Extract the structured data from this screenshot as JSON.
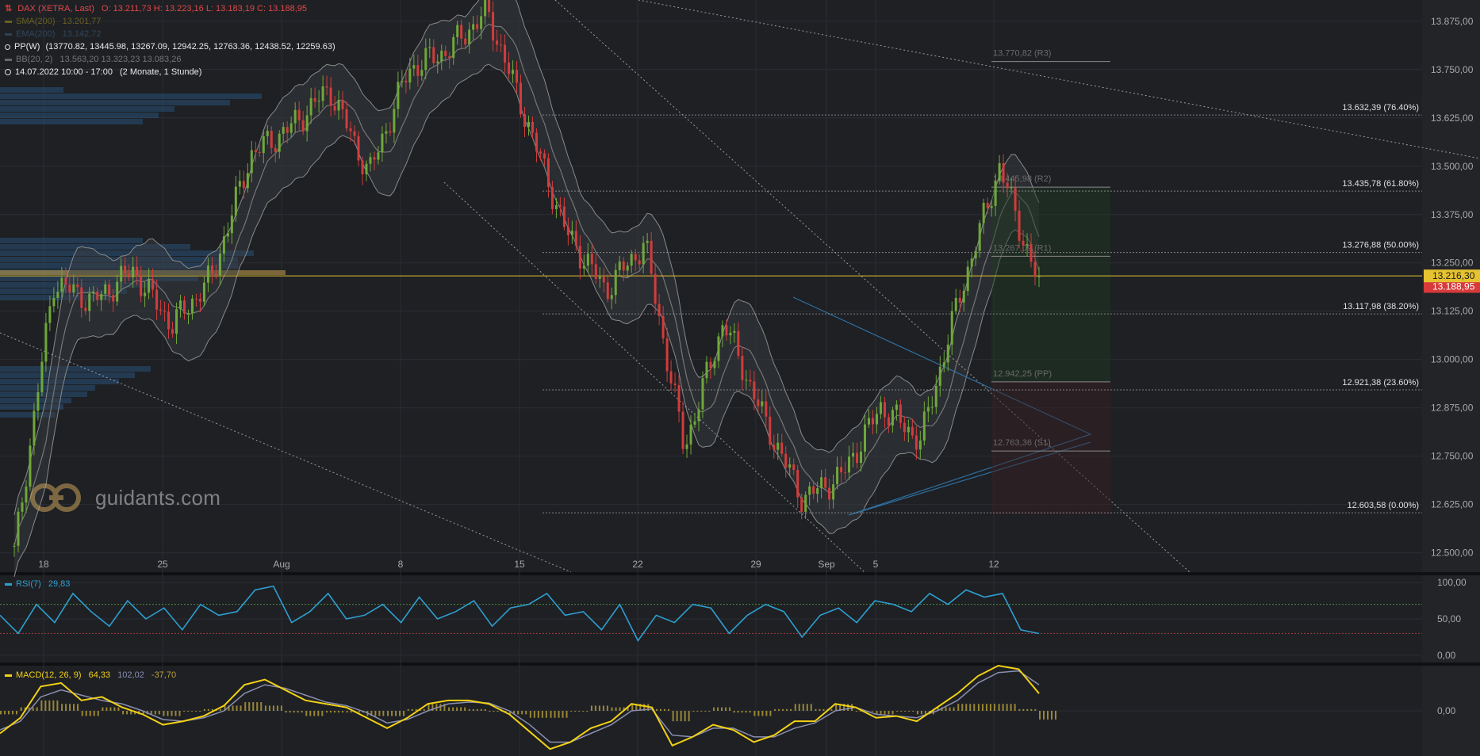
{
  "header": {
    "symbol": "DAX (XETRA, Last)",
    "ohlc": "O: 13.211,73  H: 13.223,16  L: 13.183,19  C: 13.188,95",
    "sma_label": "SMA(200)",
    "sma_value": "13.201,77",
    "ema_label": "EMA(200)",
    "ema_value": "13.142,72",
    "pp_label": "PP(W)",
    "pp_values": "(13770.82, 13445.98, 13267.09, 12942.25, 12763.36, 12438.52, 12259.63)",
    "bb_label": "BB(20, 2)",
    "bb_values": "13.563,20  13.323,23  13.083,26",
    "period": "14.07.2022 10:00 - 17:00",
    "period_note": "(2 Monate, 1 Stunde)"
  },
  "brand": {
    "text": "guidants.com"
  },
  "colors": {
    "up": "#6fa83a",
    "down": "#d23c3c",
    "rsi": "#2e9fd0",
    "macd": "#f2d114",
    "signal": "#8a8fb0",
    "hist": "#b8a03a",
    "price_marker": "#e5c22f",
    "close_marker": "#d83a3a"
  },
  "chart_data": [
    {
      "type": "line",
      "title": "DAX (XETRA, Last)",
      "price_axis_ticks": [
        "13.875,00",
        "13.750,00",
        "13.625,00",
        "13.500,00",
        "13.375,00",
        "13.250,00",
        "13.125,00",
        "13.000,00",
        "12.875,00",
        "12.750,00",
        "12.625,00",
        "12.500,00"
      ],
      "date_axis_ticks": [
        "18",
        "25",
        "Aug",
        "8",
        "15",
        "22",
        "29",
        "Sep",
        "5",
        "12"
      ],
      "ylim": [
        12450,
        13930
      ],
      "price_markers": {
        "last": "13.216,30",
        "close": "13.188,95"
      },
      "close_approx": [
        {
          "x": "18",
          "y": 12500
        },
        {
          "x": "20",
          "y": 13200
        },
        {
          "x": "22",
          "y": 13150
        },
        {
          "x": "25",
          "y": 13230
        },
        {
          "x": "27",
          "y": 13090
        },
        {
          "x": "Aug",
          "y": 13210
        },
        {
          "x": "3",
          "y": 13530
        },
        {
          "x": "5",
          "y": 13600
        },
        {
          "x": "8",
          "y": 13700
        },
        {
          "x": "10",
          "y": 13480
        },
        {
          "x": "12",
          "y": 13750
        },
        {
          "x": "15",
          "y": 13800
        },
        {
          "x": "16",
          "y": 13900
        },
        {
          "x": "18",
          "y": 13620
        },
        {
          "x": "22",
          "y": 13330
        },
        {
          "x": "24",
          "y": 13180
        },
        {
          "x": "26",
          "y": 13300
        },
        {
          "x": "29",
          "y": 12770
        },
        {
          "x": "31",
          "y": 13100
        },
        {
          "x": "Sep",
          "y": 12850
        },
        {
          "x": "2",
          "y": 12640
        },
        {
          "x": "5",
          "y": 12700
        },
        {
          "x": "7",
          "y": 12880
        },
        {
          "x": "9",
          "y": 12790
        },
        {
          "x": "12",
          "y": 13170
        },
        {
          "x": "13",
          "y": 13500
        },
        {
          "x": "14",
          "y": 13189
        }
      ],
      "fibonacci_levels": [
        {
          "label": "13.632,39 (76.40%)",
          "value": 13632.39
        },
        {
          "label": "13.435,78 (61.80%)",
          "value": 13435.78
        },
        {
          "label": "13.276,88 (50.00%)",
          "value": 13276.88
        },
        {
          "label": "13.117,98 (38.20%)",
          "value": 13117.98
        },
        {
          "label": "12.921,38 (23.60%)",
          "value": 12921.38
        },
        {
          "label": "12.603,58 (0.00%)",
          "value": 12603.58
        }
      ],
      "pivot_levels": [
        {
          "label": "13.770,82 (R3)",
          "value": 13770.82
        },
        {
          "label": "13.445,98 (R2)",
          "value": 13445.98
        },
        {
          "label": "13.267,09 (R1)",
          "value": 13267.09
        },
        {
          "label": "12.942,25 (PP)",
          "value": 12942.25
        },
        {
          "label": "12.763,36 (S1)",
          "value": 12763.36
        }
      ]
    },
    {
      "type": "line",
      "title": "RSI(7)",
      "value_label": "29,83",
      "axis_ticks": [
        "100,00",
        "50,00",
        "0,00"
      ],
      "ylim": [
        -10,
        110
      ],
      "overbought": 70,
      "oversold": 30,
      "values_approx": [
        55,
        30,
        70,
        45,
        85,
        60,
        40,
        75,
        50,
        65,
        35,
        70,
        55,
        60,
        90,
        95,
        45,
        60,
        85,
        50,
        55,
        70,
        45,
        80,
        50,
        60,
        75,
        40,
        65,
        70,
        85,
        55,
        60,
        35,
        70,
        20,
        55,
        45,
        70,
        65,
        30,
        55,
        70,
        60,
        25,
        55,
        65,
        45,
        75,
        70,
        60,
        85,
        70,
        90,
        80,
        85,
        35,
        29.83
      ]
    },
    {
      "type": "line",
      "title": "MACD(12, 26, 9)",
      "macd_value": "64,33",
      "signal_value": "102,02",
      "hist_value": "-37,70",
      "axis_ticks": [
        "0,00"
      ],
      "ylim": [
        -260,
        260
      ],
      "macd_approx": [
        -130,
        -40,
        140,
        160,
        60,
        80,
        20,
        -20,
        -80,
        -60,
        -30,
        30,
        150,
        180,
        120,
        60,
        40,
        20,
        -40,
        -100,
        -40,
        40,
        60,
        60,
        40,
        -20,
        -120,
        -220,
        -180,
        -100,
        -60,
        40,
        20,
        -200,
        -150,
        -80,
        -110,
        -180,
        -140,
        -60,
        -60,
        40,
        20,
        -40,
        -30,
        -60,
        20,
        100,
        200,
        260,
        240,
        100
      ],
      "signal_approx": [
        -110,
        -60,
        80,
        120,
        90,
        60,
        40,
        0,
        -50,
        -60,
        -40,
        0,
        100,
        150,
        130,
        90,
        50,
        30,
        -10,
        -70,
        -50,
        0,
        40,
        50,
        45,
        0,
        -80,
        -180,
        -180,
        -130,
        -80,
        0,
        10,
        -140,
        -150,
        -100,
        -100,
        -150,
        -150,
        -100,
        -70,
        0,
        20,
        -20,
        -30,
        -40,
        0,
        60,
        160,
        220,
        230,
        150
      ]
    }
  ]
}
